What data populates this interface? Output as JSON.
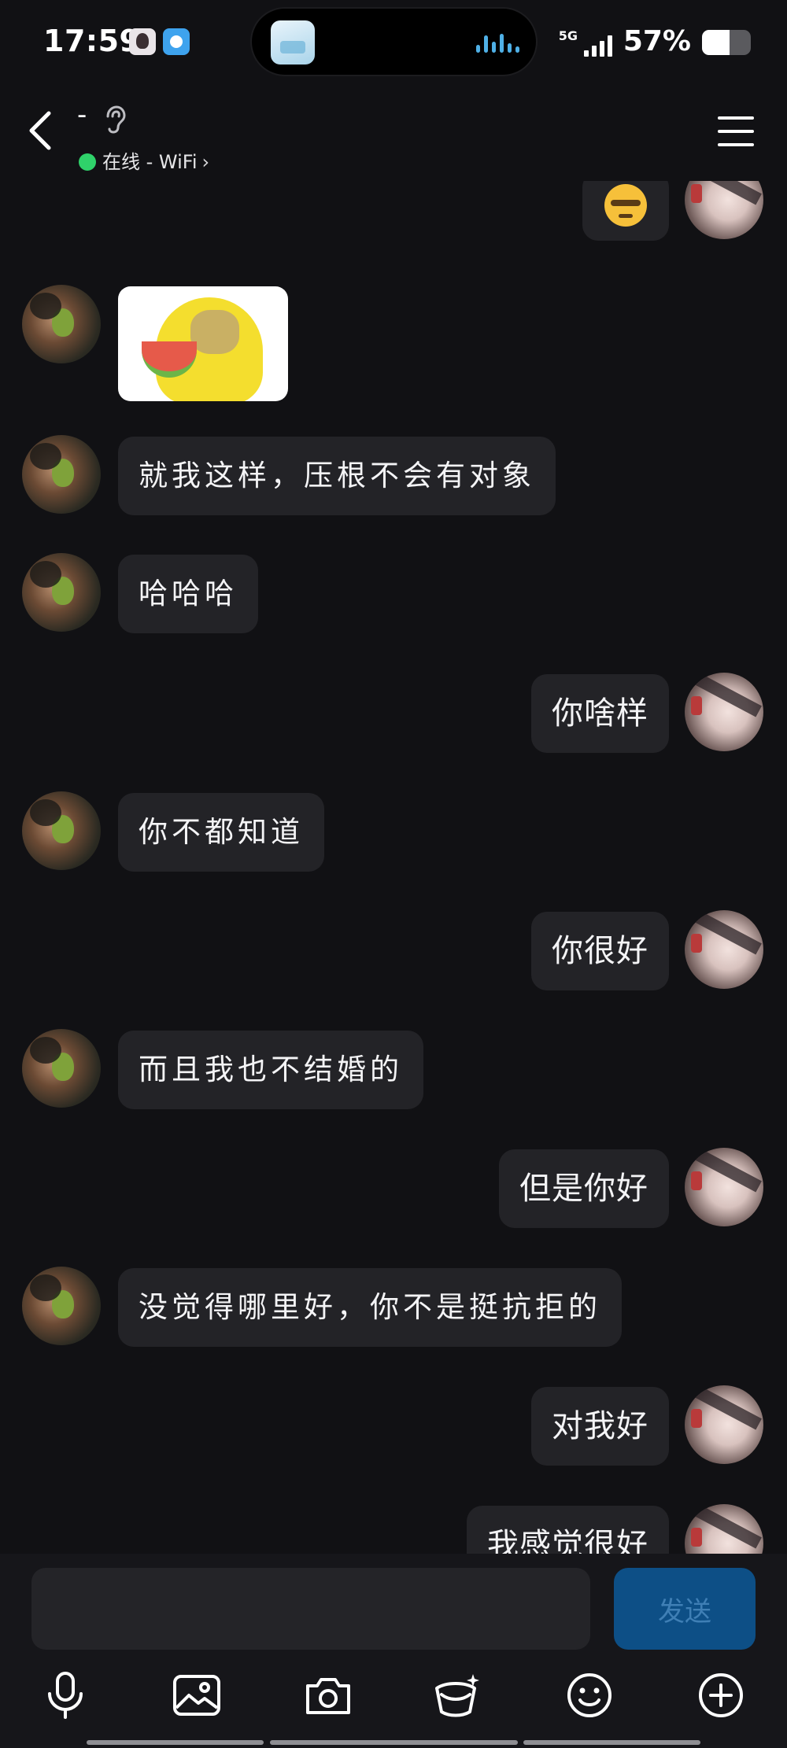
{
  "status_bar": {
    "time": "17:59",
    "network": "5G",
    "battery_text": "57%",
    "battery_level": 0.57
  },
  "header": {
    "title": "-",
    "status": "在线 - WiFi",
    "online_color": "#2fd26a"
  },
  "messages": [
    {
      "side": "right",
      "type": "emoji",
      "icon": "sunglasses-face-emoji"
    },
    {
      "side": "left",
      "type": "sticker",
      "icon": "yellow-meme-sticker"
    },
    {
      "side": "left",
      "type": "text",
      "text": "就我这样，压根不会有对象"
    },
    {
      "side": "left",
      "type": "text",
      "text": "哈哈哈"
    },
    {
      "side": "right",
      "type": "text",
      "text": "你啥样"
    },
    {
      "side": "left",
      "type": "text",
      "text": "你不都知道"
    },
    {
      "side": "right",
      "type": "text",
      "text": "你很好"
    },
    {
      "side": "left",
      "type": "text",
      "text": "而且我也不结婚的"
    },
    {
      "side": "right",
      "type": "text",
      "text": "但是你好"
    },
    {
      "side": "left",
      "type": "text",
      "text": "没觉得哪里好，你不是挺抗拒的"
    },
    {
      "side": "right",
      "type": "text",
      "text": "对我好"
    },
    {
      "side": "right",
      "type": "text",
      "text": "我感觉很好"
    }
  ],
  "input": {
    "value": "",
    "placeholder": "",
    "send_label": "发送"
  },
  "toolbar": [
    "microphone-icon",
    "image-icon",
    "camera-icon",
    "red-packet-icon",
    "emoji-icon",
    "plus-icon"
  ],
  "colors": {
    "background": "#111114",
    "bubble": "#232327",
    "send_button": "#0d4f86"
  }
}
